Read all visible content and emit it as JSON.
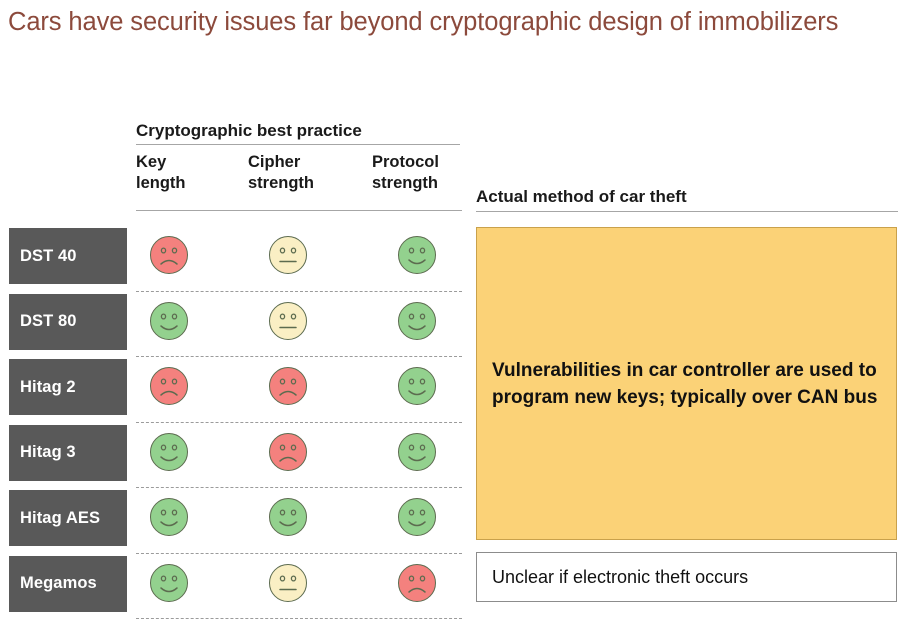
{
  "title": "Cars have security issues far beyond cryptographic design of immobilizers",
  "group_header": {
    "label": "Cryptographic best practice"
  },
  "columns": [
    {
      "id": "key-length",
      "label": "Key\nlength"
    },
    {
      "id": "cipher-strength",
      "label": "Cipher\nstrength"
    },
    {
      "id": "protocol-strength",
      "label": "Protocol\nstrength"
    }
  ],
  "right_header": {
    "label": "Actual method of car theft"
  },
  "rows": [
    {
      "id": "dst-40",
      "label": "DST 40",
      "ratings": [
        "sad",
        "neutral",
        "happy"
      ]
    },
    {
      "id": "dst-80",
      "label": "DST 80",
      "ratings": [
        "happy",
        "neutral",
        "happy"
      ]
    },
    {
      "id": "hitag-2",
      "label": "Hitag 2",
      "ratings": [
        "sad",
        "sad",
        "happy"
      ]
    },
    {
      "id": "hitag-3",
      "label": "Hitag 3",
      "ratings": [
        "happy",
        "sad",
        "happy"
      ]
    },
    {
      "id": "hitag-aes",
      "label": "Hitag AES",
      "ratings": [
        "happy",
        "happy",
        "happy"
      ]
    },
    {
      "id": "megamos",
      "label": "Megamos",
      "ratings": [
        "happy",
        "neutral",
        "sad"
      ]
    }
  ],
  "callout": {
    "text": "Vulnerabilities in car controller are used to program new keys; typically over CAN bus"
  },
  "note": {
    "text": "Unclear if electronic theft occurs"
  },
  "colors": {
    "title": "#8C4A3C",
    "row_label_bg": "#595959",
    "callout_bg": "#FBD277",
    "callout_border": "#C9A14B",
    "face_happy": "#93D18E",
    "face_neutral": "#FAEFC4",
    "face_sad": "#F4817E",
    "face_stroke": "#5C6B4F",
    "rule": "#A6A6A6",
    "divider": "#9B9B9B"
  },
  "icon_names": {
    "happy": "smiley-happy-icon",
    "neutral": "smiley-neutral-icon",
    "sad": "smiley-sad-icon"
  }
}
